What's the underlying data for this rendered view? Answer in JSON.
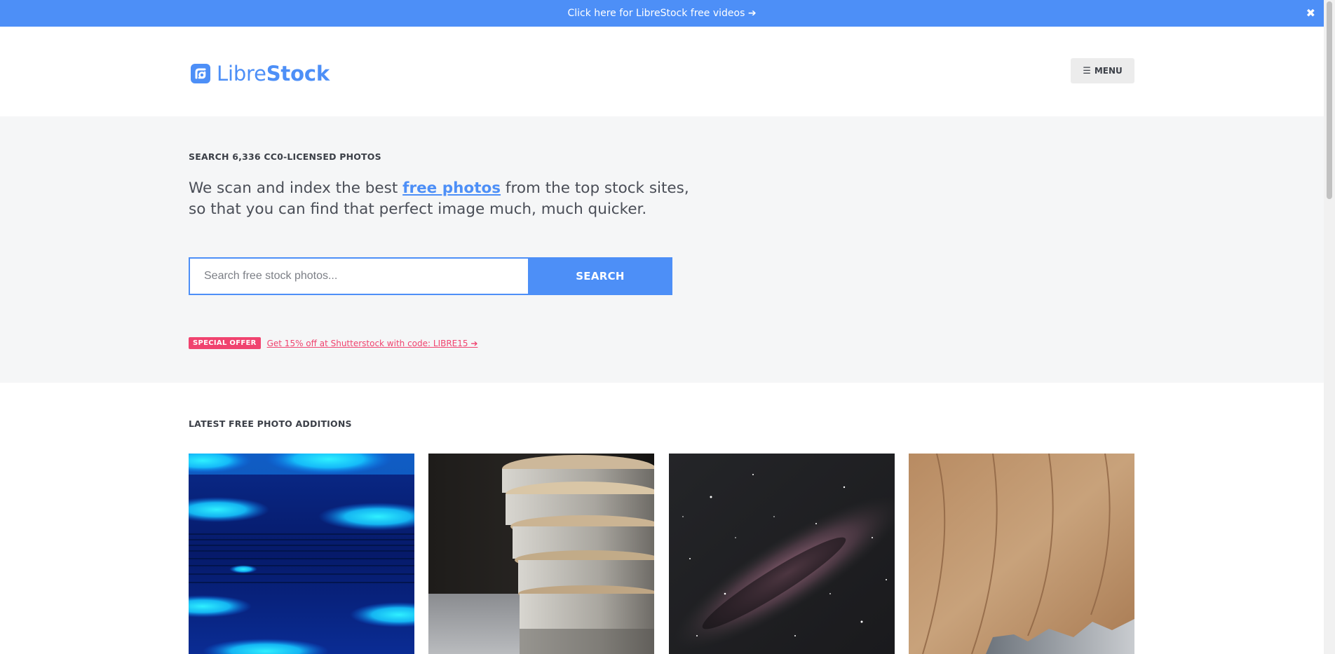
{
  "top_banner": {
    "text": "Click here for LibreStock free videos",
    "arrow": "➔",
    "close": "✖"
  },
  "header": {
    "logo_light": "Libre",
    "logo_bold": "Stock",
    "menu_icon": "☰",
    "menu_label": "MENU"
  },
  "hero": {
    "kicker": "SEARCH 6,336 CC0-LICENSED PHOTOS",
    "text_before": "We scan and index the best ",
    "text_link": "free photos",
    "text_after": " from the top stock sites, so that you can find that perfect image much, much quicker.",
    "search_placeholder": "Search free stock photos...",
    "search_value": "",
    "search_button": "SEARCH",
    "offer_badge": "SPECIAL OFFER",
    "offer_link": "Get 15% off at Shutterstock with code: LIBRE15 ➔"
  },
  "latest": {
    "title": "LATEST FREE PHOTO ADDITIONS",
    "photos": [
      {
        "subject": "blue-light-bokeh-photo"
      },
      {
        "subject": "stacked-birch-wood-slices-photo"
      },
      {
        "subject": "milky-way-night-sky-photo"
      },
      {
        "subject": "dry-leaf-texture-photo"
      }
    ]
  },
  "colors": {
    "accent": "#4d8ff7",
    "offer": "#f0436f",
    "hero_bg": "#f5f6f7"
  }
}
